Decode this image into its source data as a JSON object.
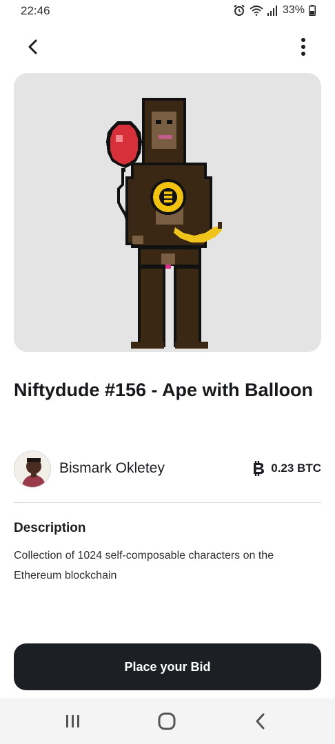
{
  "status_bar": {
    "time": "22:46",
    "battery": "33%",
    "icons": [
      "alarm-icon",
      "wifi-icon",
      "signal-icon",
      "battery-icon"
    ]
  },
  "nav": {
    "back_icon": "chevron-left-icon",
    "more_icon": "more-vertical-icon"
  },
  "nft": {
    "title": "Niftydude #156 - Ape with Balloon",
    "image_icon": "pixel-ape-with-balloon-image",
    "card_color": "#e3e4e3"
  },
  "owner": {
    "name": "Bismark Okletey",
    "avatar_icon": "user-avatar"
  },
  "price": {
    "currency_icon": "bitcoin-icon",
    "value": "0.23 BTC"
  },
  "description": {
    "heading": "Description",
    "text": "Collection of 1024 self-composable characters on the Ethereum blockchain"
  },
  "actions": {
    "bid_label": "Place your Bid",
    "bid_color": "#1c1f24"
  },
  "system_nav": {
    "recents_icon": "recents-icon",
    "home_icon": "home-icon",
    "back_icon": "back-icon"
  }
}
